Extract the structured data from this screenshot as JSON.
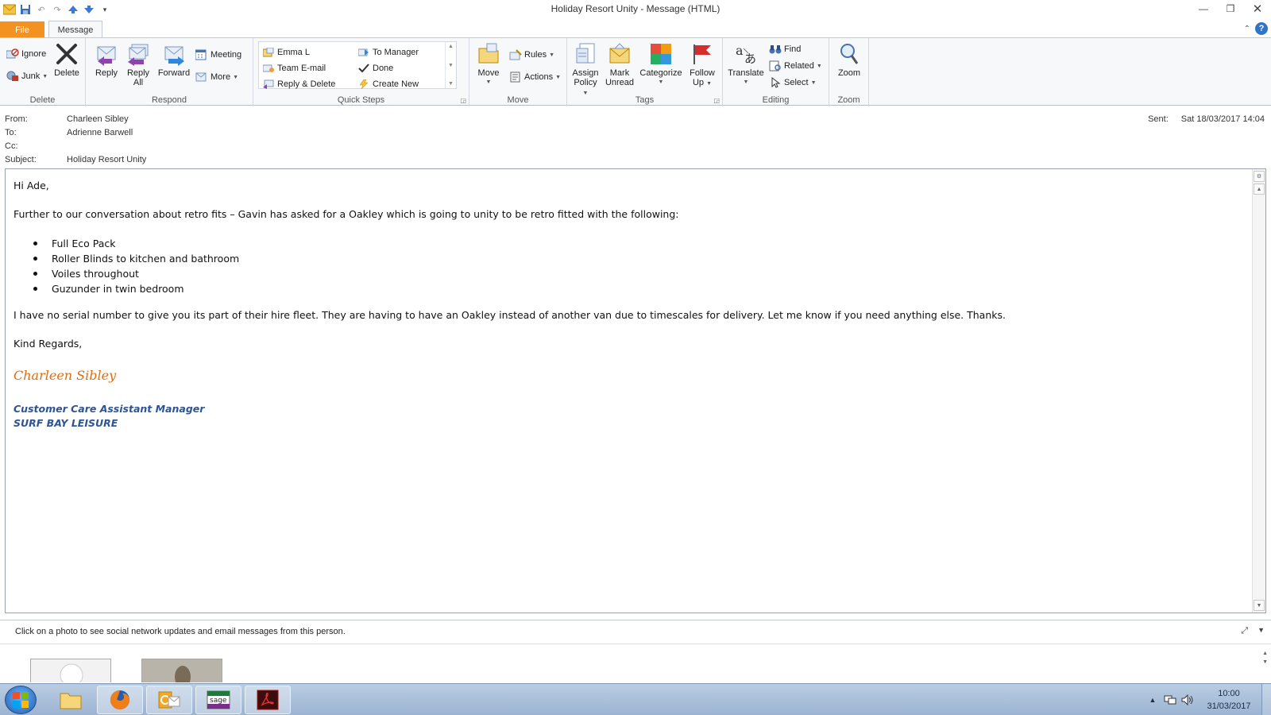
{
  "window": {
    "title": "Holiday Resort Unity  -  Message (HTML)"
  },
  "tabs": {
    "file": "File",
    "message": "Message"
  },
  "ribbon": {
    "delete_group": {
      "label": "Delete",
      "ignore": "Ignore",
      "junk": "Junk",
      "delete": "Delete"
    },
    "respond_group": {
      "label": "Respond",
      "reply": "Reply",
      "reply_all_1": "Reply",
      "reply_all_2": "All",
      "forward": "Forward",
      "meeting": "Meeting",
      "more": "More"
    },
    "quick_steps_group": {
      "label": "Quick Steps",
      "items": [
        "Emma L",
        "To Manager",
        "Team E-mail",
        "Done",
        "Reply & Delete",
        "Create New"
      ]
    },
    "move_group": {
      "label": "Move",
      "move": "Move",
      "rules": "Rules",
      "actions": "Actions"
    },
    "tags_group": {
      "label": "Tags",
      "assign_1": "Assign",
      "assign_2": "Policy",
      "mark_1": "Mark",
      "mark_2": "Unread",
      "categorize": "Categorize",
      "follow_1": "Follow",
      "follow_2": "Up"
    },
    "editing_group": {
      "label": "Editing",
      "translate": "Translate",
      "find": "Find",
      "related": "Related",
      "select": "Select"
    },
    "zoom_group": {
      "label": "Zoom",
      "zoom": "Zoom"
    }
  },
  "header": {
    "from_label": "From:",
    "from": "Charleen Sibley",
    "to_label": "To:",
    "to": "Adrienne Barwell",
    "cc_label": "Cc:",
    "cc": "",
    "subject_label": "Subject:",
    "subject": "Holiday Resort Unity",
    "sent_label": "Sent:",
    "sent": "Sat 18/03/2017 14:04"
  },
  "body": {
    "greeting": "Hi Ade,",
    "para1": "Further to our conversation about retro fits – Gavin has asked for a Oakley which is going to unity to be retro fitted with the following:",
    "bullets": [
      "Full Eco Pack",
      "Roller Blinds to kitchen and bathroom",
      "Voiles throughout",
      "Guzunder in twin bedroom"
    ],
    "para2": "I have no serial number to give you its part of their hire fleet.  They are having to have an Oakley instead of another van due to timescales for delivery.  Let me know if you need anything else. Thanks.",
    "closing": "Kind Regards,",
    "signature_name": "Charleen Sibley",
    "signature_title": "Customer Care Assistant Manager",
    "signature_company": "SURF BAY LEISURE"
  },
  "people_pane": {
    "text": "Click on a photo to see social network updates and email messages from this person."
  },
  "taskbar": {
    "time": "10:00",
    "date": "31/03/2017"
  },
  "colors": {
    "file_tab": "#f39220",
    "signature_name": "#e36c0a",
    "signature_title": "#2f5496"
  }
}
